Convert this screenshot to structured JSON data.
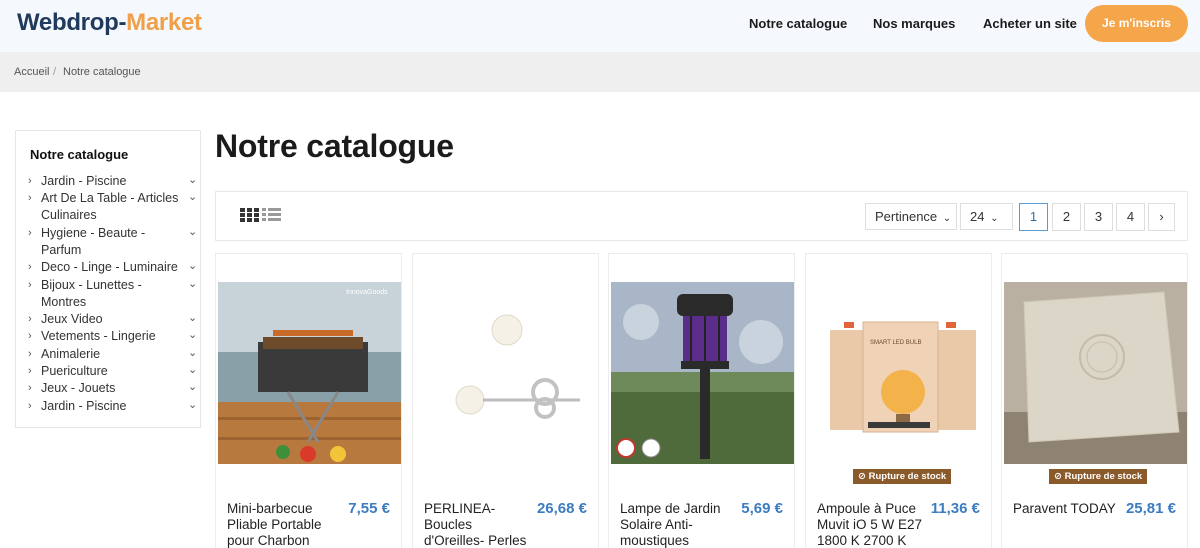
{
  "header": {
    "logo_part1": "Webdrop-",
    "logo_part2": "Market",
    "nav": [
      "Notre catalogue",
      "Nos marques",
      "Acheter un site"
    ],
    "signup_label": "Je m'inscris"
  },
  "breadcrumb": {
    "items": [
      "Accueil",
      "Notre catalogue"
    ],
    "separator": "/"
  },
  "sidebar": {
    "title": "Notre catalogue",
    "categories": [
      {
        "label": "Jardin - Piscine"
      },
      {
        "label": "Art De La Table - Articles Culinaires"
      },
      {
        "label": "Hygiene - Beaute - Parfum"
      },
      {
        "label": "Deco - Linge - Luminaire"
      },
      {
        "label": "Bijoux - Lunettes - Montres"
      },
      {
        "label": "Jeux Video"
      },
      {
        "label": "Vetements - Lingerie"
      },
      {
        "label": "Animalerie"
      },
      {
        "label": "Puericulture"
      },
      {
        "label": "Jeux - Jouets"
      },
      {
        "label": "Jardin - Piscine"
      }
    ]
  },
  "main": {
    "title": "Notre catalogue",
    "sort_label": "Pertinence",
    "per_page": "24",
    "pagination": [
      "1",
      "2",
      "3",
      "4"
    ],
    "current_page": "1",
    "next_symbol": "›"
  },
  "products": [
    {
      "name": "Mini-barbecue Pliable Portable pour Charbon",
      "price": "7,55 €",
      "image": "barbecue"
    },
    {
      "name": "PERLINEA- Boucles d'Oreilles- Perles",
      "price": "26,68 €",
      "image": "pearl-earrings"
    },
    {
      "name": "Lampe de Jardin Solaire Anti-moustiques",
      "price": "5,69 €",
      "image": "solar-lamp"
    },
    {
      "name": "Ampoule à Puce Muvit iO 5 W E27 1800 K 2700 K",
      "price": "11,36 €",
      "image": "led-bulb-box",
      "badge": "Rupture de stock"
    },
    {
      "name": "Paravent TODAY",
      "price": "25,81 €",
      "image": "cushion",
      "badge": "Rupture de stock"
    }
  ],
  "image_text": {
    "barbecue_brand": "InnovaGoods",
    "bulb_box_text": "SMART LED BULB"
  },
  "colors": {
    "accent": "#f5a64a",
    "price": "#3b7cc2",
    "logo_dark": "#1f3a5c",
    "out_of_stock": "#8a5a2b"
  }
}
